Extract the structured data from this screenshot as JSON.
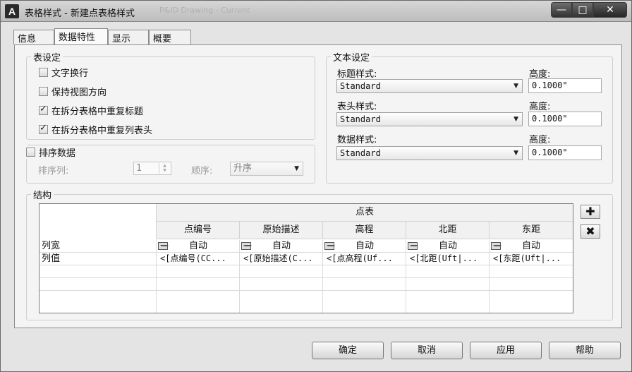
{
  "window": {
    "app_icon": "A",
    "title": "表格样式 - 新建点表格样式",
    "ghost_title": "P&ID Drawing - Current",
    "controls": {
      "minimize": "—",
      "maximize": "□",
      "close": "✕"
    }
  },
  "tabs": [
    {
      "label": "信息",
      "active": false
    },
    {
      "label": "数据特性",
      "active": true
    },
    {
      "label": "显示",
      "active": false
    },
    {
      "label": "概要",
      "active": false
    }
  ],
  "table_settings": {
    "legend": "表设定",
    "options": [
      {
        "label": "文字换行",
        "checked": false
      },
      {
        "label": "保持视图方向",
        "checked": false
      },
      {
        "label": "在拆分表格中重复标题",
        "checked": true
      },
      {
        "label": "在拆分表格中重复列表头",
        "checked": true
      }
    ]
  },
  "sort": {
    "label": "排序数据",
    "checked": false,
    "column_label": "排序列:",
    "column_value": "1",
    "order_label": "顺序:",
    "order_value": "升序"
  },
  "text_settings": {
    "legend": "文本设定",
    "title_style_label": "标题样式:",
    "title_style_value": "Standard",
    "title_height_label": "高度:",
    "title_height_value": "0.1000\"",
    "header_style_label": "表头样式:",
    "header_style_value": "Standard",
    "header_height_label": "高度:",
    "header_height_value": "0.1000\"",
    "data_style_label": "数据样式:",
    "data_style_value": "Standard",
    "data_height_label": "高度:",
    "data_height_value": "0.1000\""
  },
  "structure": {
    "legend": "结构",
    "table_title": "点表",
    "columns": [
      "点编号",
      "原始描述",
      "高程",
      "北距",
      "东距"
    ],
    "row_labels": [
      "列宽",
      "列值"
    ],
    "width_values": [
      "自动",
      "自动",
      "自动",
      "自动",
      "自动"
    ],
    "column_values": [
      "<[点编号(CC...",
      "<[原始描述(C...",
      "<[点高程(Uf...",
      "<[北距(Uft|...",
      "<[东距(Uft|..."
    ],
    "add_icon": "add-column-icon",
    "delete_icon": "delete-column-icon"
  },
  "buttons": {
    "ok": "确定",
    "cancel": "取消",
    "apply": "应用",
    "help": "帮助"
  }
}
